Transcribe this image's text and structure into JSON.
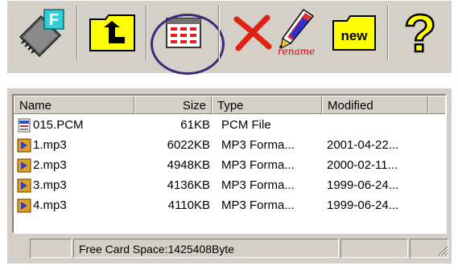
{
  "toolbar": {
    "buttons": [
      {
        "name": "format-card",
        "icon": "memory-card-format-icon"
      },
      {
        "name": "up-folder",
        "icon": "folder-up-icon"
      },
      {
        "name": "view-list",
        "icon": "list-view-icon",
        "highlighted": true
      },
      {
        "name": "delete",
        "icon": "red-x-delete-icon"
      },
      {
        "name": "rename",
        "icon": "pencil-rename-icon",
        "label": "rename"
      },
      {
        "name": "new-folder",
        "icon": "new-folder-icon",
        "label": "new"
      },
      {
        "name": "help",
        "icon": "question-mark-icon",
        "label": "?"
      }
    ],
    "rename_label": "rename",
    "new_label": "new",
    "help_label": "?"
  },
  "columns": [
    {
      "label": "Name"
    },
    {
      "label": "Size"
    },
    {
      "label": "Type"
    },
    {
      "label": "Modified"
    }
  ],
  "files": [
    {
      "name": "015.PCM",
      "size": "61KB",
      "type": "PCM File",
      "modified": "",
      "icon": "pcm-file-icon"
    },
    {
      "name": "1.mp3",
      "size": "6022KB",
      "type": "MP3 Forma...",
      "modified": "2001-04-22...",
      "icon": "mp3-file-icon"
    },
    {
      "name": "2.mp3",
      "size": "4948KB",
      "type": "MP3 Forma...",
      "modified": "2000-02-11...",
      "icon": "mp3-file-icon"
    },
    {
      "name": "3.mp3",
      "size": "4136KB",
      "type": "MP3 Forma...",
      "modified": "1999-06-24...",
      "icon": "mp3-file-icon"
    },
    {
      "name": "4.mp3",
      "size": "4110KB",
      "type": "MP3 Forma...",
      "modified": "1999-06-24...",
      "icon": "mp3-file-icon"
    }
  ],
  "status": {
    "free_space": "Free Card Space:1425408Byte"
  },
  "colors": {
    "chrome": "#d4d0c8",
    "highlight_circle": "#3a2a7a",
    "rename_text": "#d40000",
    "folder_yellow": "#ffff00"
  }
}
